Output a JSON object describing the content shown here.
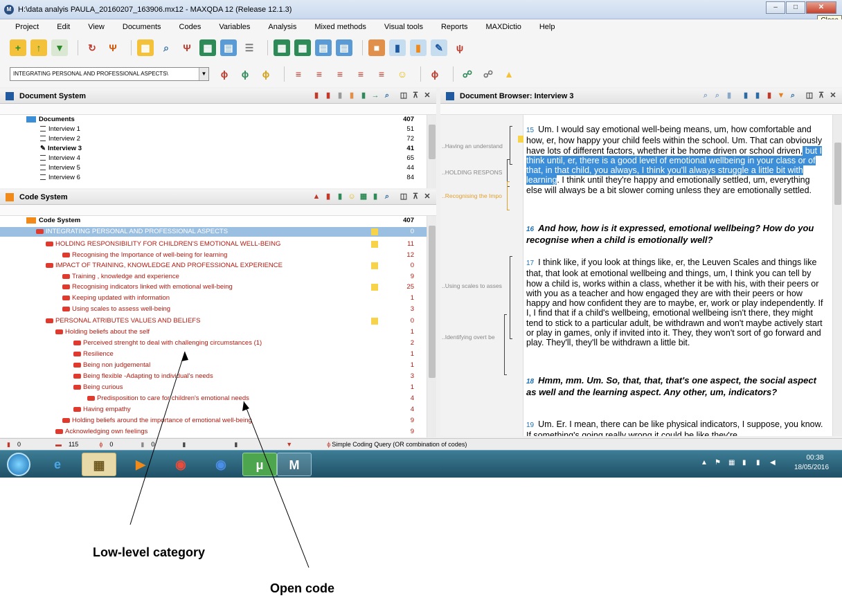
{
  "window": {
    "title": "H:\\data analyis PAULA_20160207_163906.mx12 - MAXQDA 12  (Release 12.1.3)",
    "close_tooltip": "Close"
  },
  "menu": [
    "Project",
    "Edit",
    "View",
    "Documents",
    "Codes",
    "Variables",
    "Analysis",
    "Mixed methods",
    "Visual tools",
    "Reports",
    "MAXDictio",
    "Help"
  ],
  "toolbar2": {
    "combo_value": "INTEGRATING PERSONAL AND PROFESSIONAL ASPECTS\\"
  },
  "document_system": {
    "title": "Document System",
    "root": {
      "label": "Documents",
      "count": "407"
    },
    "items": [
      {
        "label": "Interview 1",
        "count": "51"
      },
      {
        "label": "Interview 2",
        "count": "72"
      },
      {
        "label": "Interview 3",
        "count": "41"
      },
      {
        "label": "Interview 4",
        "count": "65"
      },
      {
        "label": "Interview 5",
        "count": "44"
      },
      {
        "label": "Interview 6",
        "count": "84"
      }
    ]
  },
  "code_system": {
    "title": "Code System",
    "root": {
      "label": "Code System",
      "count": "407"
    },
    "items": [
      {
        "label": "INTEGRATING PERSONAL AND PROFESSIONAL ASPECTS",
        "count": "0"
      },
      {
        "label": "HOLDING RESPONSIBILITY FOR CHILDREN'S EMOTIONAL WELL-BEING",
        "count": "11"
      },
      {
        "label": "Recognising the Importance of well-being for learning",
        "count": "12"
      },
      {
        "label": "IMPACT OF TRAINING, KNOWLEDGE AND PROFESSIONAL EXPERIENCE",
        "count": "0"
      },
      {
        "label": "Training , knowledge and experience",
        "count": "9"
      },
      {
        "label": "Recognising indicators linked with emotional well-being",
        "count": "25"
      },
      {
        "label": "Keeping updated with information",
        "count": "1"
      },
      {
        "label": "Using scales to assess well-being",
        "count": "3"
      },
      {
        "label": "PERSONAL ATRIBUTES VALUES AND BELIEFS",
        "count": "0"
      },
      {
        "label": "Holding beliefs about the self",
        "count": "1"
      },
      {
        "label": "Perceived strenght to deal with challenging circumstances (1)",
        "count": "2"
      },
      {
        "label": "Resilience",
        "count": "1"
      },
      {
        "label": "Being non judgemental",
        "count": "1"
      },
      {
        "label": "Being flexible -Adapting to individual's needs",
        "count": "3"
      },
      {
        "label": "Being curious",
        "count": "1"
      },
      {
        "label": "Predisposition to care for children's emotional needs",
        "count": "4"
      },
      {
        "label": "Having empathy",
        "count": "4"
      },
      {
        "label": "Holding beliefs around the importance of emotional well-being",
        "count": "9"
      },
      {
        "label": "Acknowledging own feelings",
        "count": "9"
      }
    ]
  },
  "document_browser": {
    "title": "Document Browser: Interview 3",
    "code_labels": [
      "..Having an understand",
      "..HOLDING RESPONS",
      "..Recognising the Impo",
      "..Using scales to asses",
      "..Identifying overt be"
    ],
    "paragraphs": [
      {
        "num": "15",
        "before": "Um.  I would say emotional well-being means, um, how comfortable and how, er, how happy your child feels within the school.  Um.  That can obviously have lots of different factors, whether it be home driven or school driven,",
        "highlight": " but I think until, er, there is a good level of emotional wellbeing in your class or of that, in that child, you always, I think you'll always struggle a little bit with learning",
        "after": ".  I think until they're happy and emotionally settled, um, everything else will always be a bit slower coming unless they are emotionally settled."
      },
      {
        "num": "16",
        "text": "And how, how is it expressed, emotional wellbeing?  How do you recognise when a child is emotionally well?"
      },
      {
        "num": "17",
        "text": "I think like, if you look at things like, er, the Leuven Scales and things like that, that look at emotional wellbeing and things, um, I think you can tell by how a child is, works within a class, whether it be with his, with their peers or with you as a teacher and how engaged they are with their peers or how happy and how confident they are to maybe, er, work or play independently.  If I, I find that if a child's wellbeing, emotional wellbeing isn't there, they might tend to stick to a particular adult, be withdrawn and won't maybe actively start or play in games, only if invited into it.  They, they won't sort of go forward and play.  They'll, they'll be withdrawn a little bit."
      },
      {
        "num": "18",
        "text": "Hmm, mm.  Um.  So, that, that, that's one aspect, the social aspect as well and the learning aspect.  Any other, um, indicators?"
      },
      {
        "num": "19",
        "text": "Um.  Er.  I mean, there can be like physical indicators, I suppose, you know.  If something's going really wrong it could be like they're"
      }
    ]
  },
  "statusbar": {
    "docs": "0",
    "codes": "115",
    "coded_segments": "0",
    "memos": "0",
    "query": "Simple Coding Query (OR combination of codes)"
  },
  "taskbar": {
    "time": "00:38",
    "date": "18/05/2016"
  },
  "annotations": {
    "low_level": "Low-level category",
    "open_code": "Open code"
  }
}
